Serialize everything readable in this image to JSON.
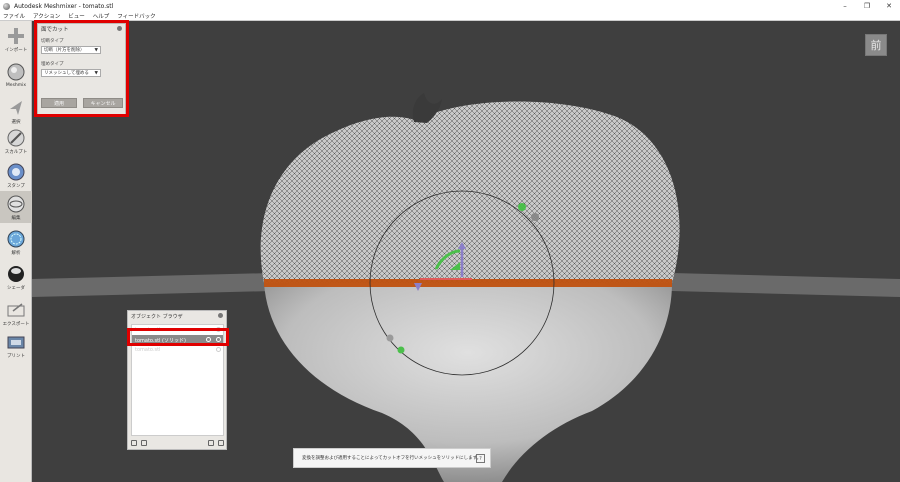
{
  "window": {
    "title": "Autodesk Meshmixer - tomato.stl",
    "controls": [
      "–",
      "❐",
      "✕"
    ]
  },
  "menu": [
    "ファイル",
    "アクション",
    "ビュー",
    "ヘルプ",
    "フィードバック"
  ],
  "toolbar": [
    {
      "label": "インポート",
      "icon": "plus-icon"
    },
    {
      "label": "Meshmix",
      "icon": "sphere-icon"
    },
    {
      "label": "選択",
      "icon": "cursor-icon"
    },
    {
      "label": "スカルプト",
      "icon": "brush-icon"
    },
    {
      "label": "スタンプ",
      "icon": "stamp-icon"
    },
    {
      "label": "編集",
      "icon": "edit-icon"
    },
    {
      "label": "解析",
      "icon": "analysis-icon"
    },
    {
      "label": "シェーダ",
      "icon": "shader-icon"
    },
    {
      "label": "エクスポート",
      "icon": "export-icon"
    },
    {
      "label": "プリント",
      "icon": "print-icon"
    }
  ],
  "cut_panel": {
    "title": "面でカット",
    "cut_type_label": "切断タイプ",
    "cut_type_value": "切断（片方を削除）",
    "fill_type_label": "埋めタイプ",
    "fill_type_value": "リメッシュして埋める",
    "apply_label": "適用",
    "cancel_label": "キャンセル"
  },
  "object_browser": {
    "title": "オブジェクト ブラウザ",
    "items": [
      {
        "name": "tomato.stl"
      },
      {
        "name": "tomato.stl (ソリッド)"
      },
      {
        "name": "tomato.stl"
      }
    ]
  },
  "hint": {
    "text": "変換を調整および適用することによってカットオフを行いメッシュをソリッドにします。",
    "help": "?"
  },
  "viewcube": {
    "label": "前"
  },
  "colors": {
    "accent_highlight": "#e00000",
    "cut_seam": "#c0510f",
    "toolbar_bg": "#e9e6e1"
  }
}
